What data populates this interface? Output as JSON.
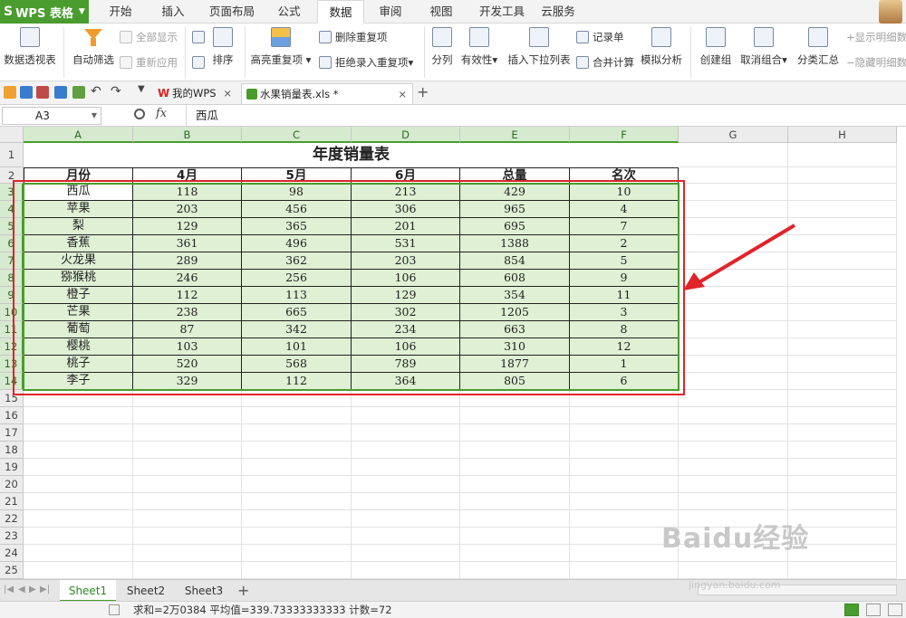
{
  "app": {
    "name": "WPS 表格"
  },
  "menu": {
    "tabs": [
      "开始",
      "插入",
      "页面布局",
      "公式",
      "数据",
      "审阅",
      "视图",
      "开发工具",
      "云服务"
    ],
    "active": "数据"
  },
  "ribbon": {
    "pivot": "数据透视表",
    "autofilter": "自动筛选",
    "show_all": "全部显示",
    "reapply": "重新应用",
    "sort": "排序",
    "highlight_dup": "高亮重复项",
    "remove_dup": "删除重复项",
    "reject_dup": "拒绝录入重复项",
    "split": "分列",
    "validity": "有效性",
    "insert_dropdown": "插入下拉列表",
    "record": "记录单",
    "consolidate": "合并计算",
    "what_if": "模拟分析",
    "group": "创建组",
    "ungroup": "取消组合",
    "subtotal": "分类汇总",
    "show_detail": "显示明细数据",
    "hide_detail": "隐藏明细数据"
  },
  "doc_tabs": {
    "wps": "我的WPS",
    "file": "水果销量表.xls *"
  },
  "formula_bar": {
    "name_box": "A3",
    "fx": "fx",
    "content": "西瓜"
  },
  "columns": [
    "A",
    "B",
    "C",
    "D",
    "E",
    "F",
    "G",
    "H"
  ],
  "rows": [
    "1",
    "2",
    "3",
    "4",
    "5",
    "6",
    "7",
    "8",
    "9",
    "10",
    "11",
    "12",
    "13",
    "14",
    "15",
    "16",
    "17",
    "18",
    "19",
    "20",
    "21",
    "22",
    "23",
    "24",
    "25"
  ],
  "table": {
    "title": "年度销量表",
    "headers": [
      "月份",
      "4月",
      "5月",
      "6月",
      "总量",
      "名次"
    ],
    "data": [
      [
        "西瓜",
        "118",
        "98",
        "213",
        "429",
        "10"
      ],
      [
        "苹果",
        "203",
        "456",
        "306",
        "965",
        "4"
      ],
      [
        "梨",
        "129",
        "365",
        "201",
        "695",
        "7"
      ],
      [
        "香蕉",
        "361",
        "496",
        "531",
        "1388",
        "2"
      ],
      [
        "火龙果",
        "289",
        "362",
        "203",
        "854",
        "5"
      ],
      [
        "猕猴桃",
        "246",
        "256",
        "106",
        "608",
        "9"
      ],
      [
        "橙子",
        "112",
        "113",
        "129",
        "354",
        "11"
      ],
      [
        "芒果",
        "238",
        "665",
        "302",
        "1205",
        "3"
      ],
      [
        "葡萄",
        "87",
        "342",
        "234",
        "663",
        "8"
      ],
      [
        "樱桃",
        "103",
        "101",
        "106",
        "310",
        "12"
      ],
      [
        "桃子",
        "520",
        "568",
        "789",
        "1877",
        "1"
      ],
      [
        "李子",
        "329",
        "112",
        "364",
        "805",
        "6"
      ]
    ]
  },
  "sheets": [
    "Sheet1",
    "Sheet2",
    "Sheet3"
  ],
  "active_sheet": "Sheet1",
  "status": {
    "text": "求和=2万0384   平均值=339.73333333333   计数=72"
  },
  "watermark": {
    "text": "Baidu经验",
    "sub": "jingyan.baidu.com"
  },
  "colors": {
    "accent": "#4a9c2e",
    "highlight": "#e0242a",
    "selection_fill": "#dff0d4"
  }
}
